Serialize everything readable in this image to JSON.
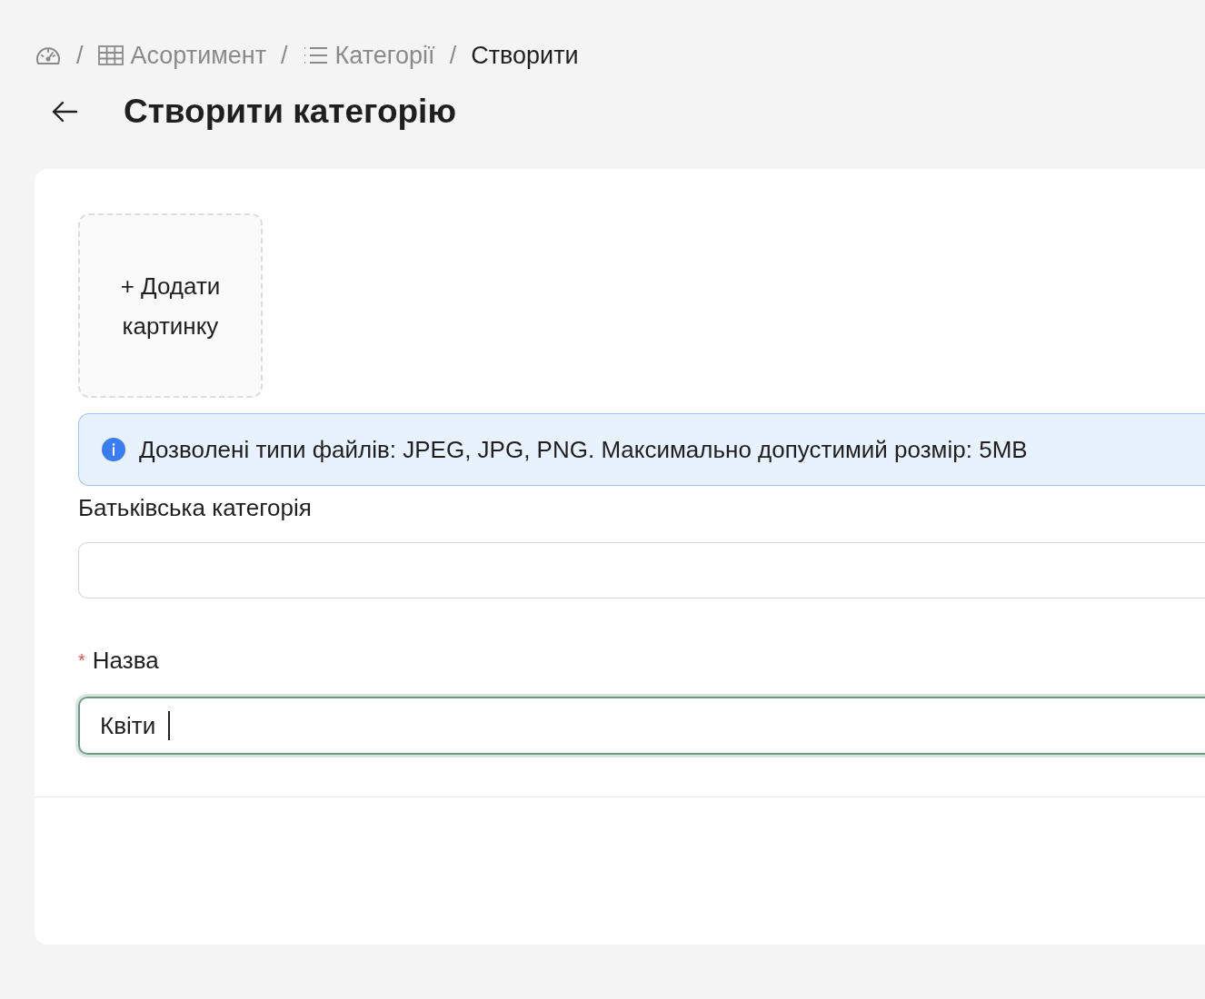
{
  "breadcrumb": [
    {
      "kind": "home",
      "current": false
    },
    {
      "kind": "table",
      "label": "Асортимент",
      "current": false
    },
    {
      "kind": "list",
      "label": "Категорії",
      "current": false
    },
    {
      "kind": "text",
      "label": "Створити",
      "current": true
    }
  ],
  "breadcrumb_separator": "/",
  "page_title": "Створити категорію",
  "upload": {
    "plus": "+",
    "label": "Додати картинку"
  },
  "alert": {
    "text": "Дозволені типи файлів: JPEG, JPG, PNG. Максимально допустимий розмір: 5MB"
  },
  "fields": [
    {
      "label": "Батьківська категорія",
      "required": false,
      "focused": false
    },
    {
      "label": "Назва",
      "value": "Квіти",
      "required": true,
      "required_mark": "*",
      "focused": true
    }
  ]
}
